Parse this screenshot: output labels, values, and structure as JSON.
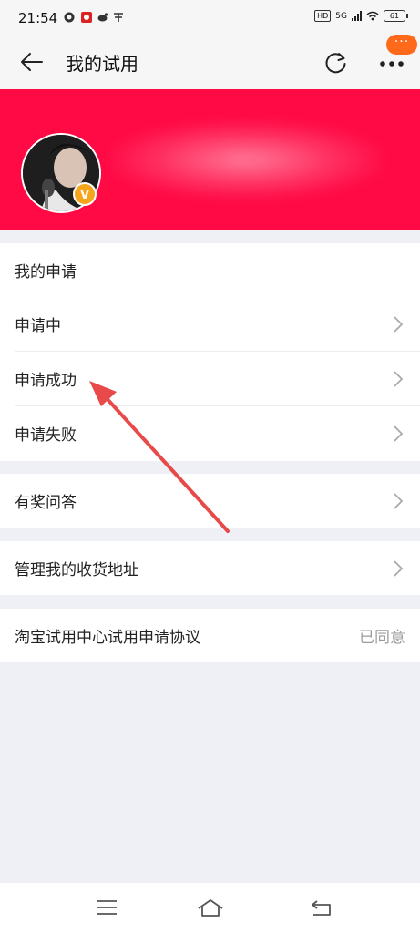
{
  "status_bar": {
    "time": "21:54",
    "network_badge": "HD",
    "network_type": "5G",
    "battery": "61"
  },
  "header": {
    "title": "我的试用",
    "badge_text": "···"
  },
  "profile": {
    "level_badge": "V"
  },
  "my_applications": {
    "section_title": "我的申请",
    "items": [
      {
        "label": "申请中"
      },
      {
        "label": "申请成功"
      },
      {
        "label": "申请失败"
      }
    ]
  },
  "qa": {
    "label": "有奖问答"
  },
  "address": {
    "label": "管理我的收货地址"
  },
  "agreement": {
    "label": "淘宝试用中心试用申请协议",
    "value": "已同意"
  },
  "colors": {
    "banner": "#ff0a45",
    "annotation_arrow": "#e84a4a",
    "badge": "#ff6a1a"
  },
  "icons": {
    "back": "arrow-left-icon",
    "refresh": "refresh-icon",
    "more": "more-dots-icon",
    "chevron": "chevron-right-icon",
    "menu": "menu-icon",
    "home": "home-icon",
    "return": "return-icon"
  }
}
